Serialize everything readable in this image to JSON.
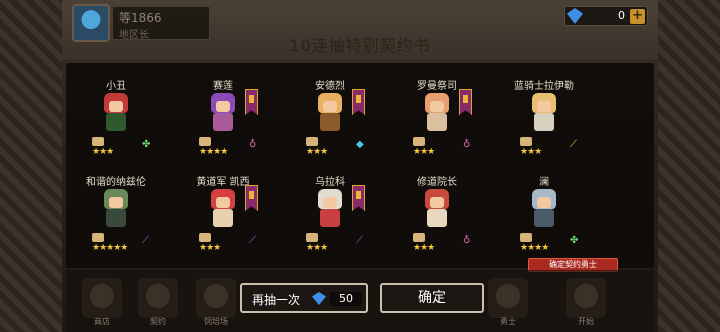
{
  "player": {
    "name": "等1866",
    "subtitle": "地区长"
  },
  "currency": {
    "icon": "diamond-icon",
    "value": "0",
    "add_label": "+"
  },
  "title": "10连抽特别契约书",
  "heroes": [
    {
      "name": "小丑",
      "stars": "★★★",
      "banner": false,
      "hair": "#c23a3a",
      "body": "#2f5a2f",
      "element": "✤",
      "element_color": "#6fd46f"
    },
    {
      "name": "赛莲",
      "stars": "★★★★",
      "banner": true,
      "hair": "#8a4ab8",
      "body": "#a85a9a",
      "element": "♁",
      "element_color": "#d86aa8"
    },
    {
      "name": "安德烈",
      "stars": "★★★",
      "banner": true,
      "hair": "#e8b060",
      "body": "#8a5a2a",
      "element": "◆",
      "element_color": "#4ac8e8"
    },
    {
      "name": "罗曼祭司",
      "stars": "★★★",
      "banner": true,
      "hair": "#e8a070",
      "body": "#d8c0a0",
      "element": "♁",
      "element_color": "#d86aa8"
    },
    {
      "name": "蓝骑士拉伊勒",
      "stars": "★★★",
      "banner": false,
      "hair": "#e8c070",
      "body": "#d8d0c0",
      "element": "⟋",
      "element_color": "#e8d040"
    },
    {
      "name": "和谐的纳兹伦",
      "stars": "★★★★★",
      "banner": false,
      "hair": "#6a8a5a",
      "body": "#3a4a3a",
      "element": "⟋",
      "element_color": "#a860e8"
    },
    {
      "name": "黄道军 凯西",
      "stars": "★★★",
      "banner": true,
      "hair": "#d84040",
      "body": "#e8d0b0",
      "element": "⟋",
      "element_color": "#a860e8"
    },
    {
      "name": "乌拉科",
      "stars": "★★★",
      "banner": true,
      "hair": "#e0dcd0",
      "body": "#c84040",
      "element": "⟋",
      "element_color": "#a860e8"
    },
    {
      "name": "修道院长",
      "stars": "★★★",
      "banner": false,
      "hair": "#c84a3a",
      "body": "#e8d8c0",
      "element": "♁",
      "element_color": "#d86aa8"
    },
    {
      "name": "澜",
      "stars": "★★★★",
      "banner": false,
      "hair": "#a8b8c8",
      "body": "#4a5a6a",
      "element": "✤",
      "element_color": "#6fd46f"
    }
  ],
  "confirm_tag": "确定契约勇士",
  "nav": [
    {
      "label": "商店",
      "icon": "shop-icon"
    },
    {
      "label": "契约",
      "icon": "contract-icon"
    },
    {
      "label": "饲培场",
      "icon": "farm-icon"
    },
    {
      "label": "勇士",
      "icon": "hero-icon"
    },
    {
      "label": "开始",
      "icon": "start-icon"
    }
  ],
  "redraw": {
    "label": "再抽一次",
    "cost": "50",
    "icon": "diamond-icon"
  },
  "confirm": {
    "label": "确定"
  }
}
